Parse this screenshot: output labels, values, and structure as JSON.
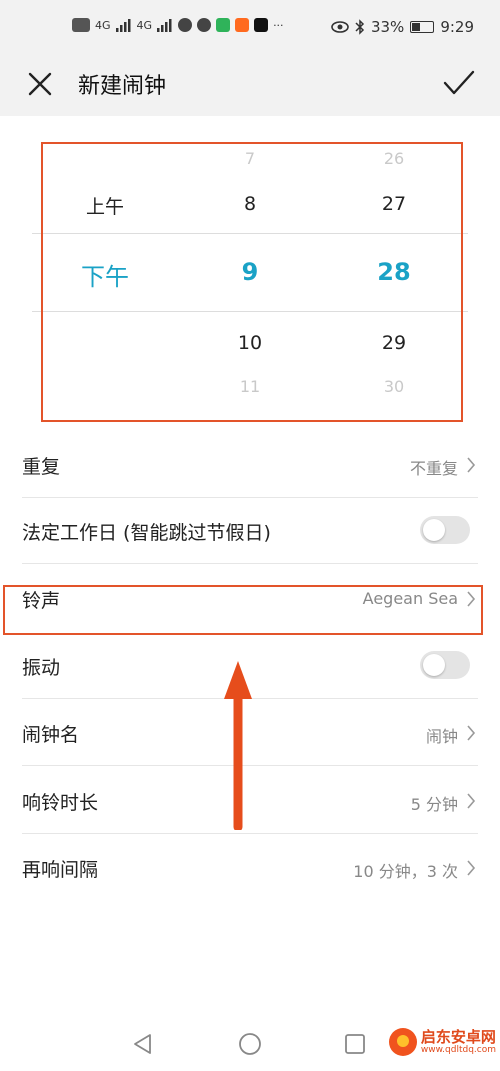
{
  "status_bar": {
    "network_1": "4G",
    "network_2": "4G",
    "battery": "33%",
    "time": "9:29",
    "more": "···"
  },
  "header": {
    "title": "新建闹钟"
  },
  "time_picker": {
    "period_column": [
      "上午",
      "下午"
    ],
    "hour_column": [
      "7",
      "8",
      "9",
      "10",
      "11"
    ],
    "minute_column": [
      "26",
      "27",
      "28",
      "29",
      "30"
    ],
    "selected": {
      "period": "下午",
      "hour": "9",
      "minute": "28"
    },
    "accent_color": "#1aa2c6"
  },
  "settings": {
    "repeat": {
      "label": "重复",
      "value": "不重复"
    },
    "workday": {
      "label": "法定工作日 (智能跳过节假日)",
      "enabled": false
    },
    "ringtone": {
      "label": "铃声",
      "value": "Aegean Sea"
    },
    "vibrate": {
      "label": "振动",
      "enabled": false
    },
    "alarm_name": {
      "label": "闹钟名",
      "value": "闹钟"
    },
    "ring_duration": {
      "label": "响铃时长",
      "value": "5 分钟"
    },
    "snooze_interval": {
      "label": "再响间隔",
      "value": "10 分钟，3 次"
    }
  },
  "annotation": {
    "highlight_color": "#e3542a",
    "arrow_color": "#e64d1c"
  },
  "watermark": {
    "name": "启东安卓网",
    "url": "www.qdltdq.com"
  }
}
